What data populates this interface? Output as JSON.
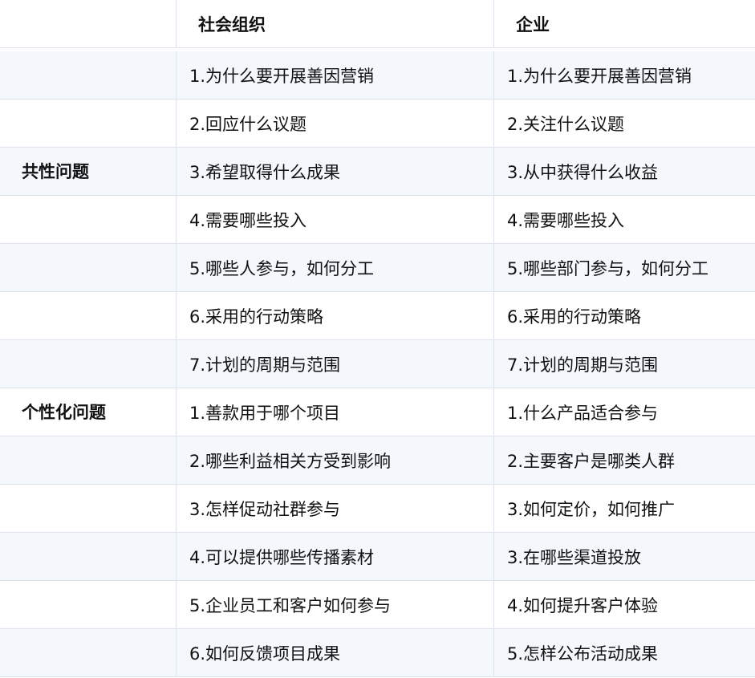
{
  "header": {
    "col1": "",
    "col2": "社会组织",
    "col3": "企业"
  },
  "groups": [
    {
      "label": "共性问题"
    },
    {
      "label": "个性化问题"
    }
  ],
  "rows": [
    {
      "org": "1.为什么要开展善因营销",
      "biz": "1.为什么要开展善因营销"
    },
    {
      "org": "2.回应什么议题",
      "biz": "2.关注什么议题"
    },
    {
      "org": "3.希望取得什么成果",
      "biz": "3.从中获得什么收益"
    },
    {
      "org": "4.需要哪些投入",
      "biz": "4.需要哪些投入"
    },
    {
      "org": "5.哪些人参与，如何分工",
      "biz": "5.哪些部门参与，如何分工"
    },
    {
      "org": "6.采用的行动策略",
      "biz": "6.采用的行动策略"
    },
    {
      "org": "7.计划的周期与范围",
      "biz": "7.计划的周期与范围"
    },
    {
      "org": "1.善款用于哪个项目",
      "biz": "1.什么产品适合参与"
    },
    {
      "org": "2.哪些利益相关方受到影响",
      "biz": "2.主要客户是哪类人群"
    },
    {
      "org": "3.怎样促动社群参与",
      "biz": "3.如何定价，如何推广"
    },
    {
      "org": "4.可以提供哪些传播素材",
      "biz": "3.在哪些渠道投放"
    },
    {
      "org": "5.企业员工和客户如何参与",
      "biz": "4.如何提升客户体验"
    },
    {
      "org": "6.如何反馈项目成果",
      "biz": "5.怎样公布活动成果"
    }
  ]
}
